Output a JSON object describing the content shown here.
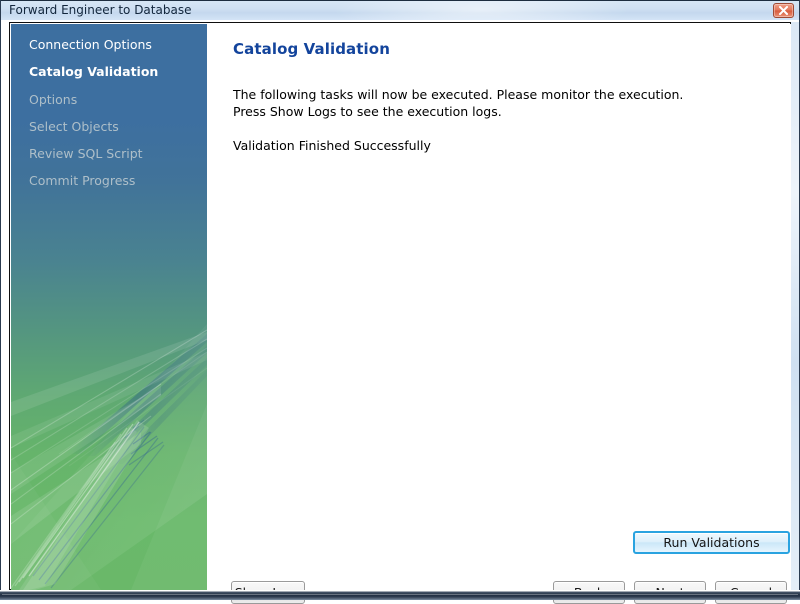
{
  "window": {
    "title": "Forward Engineer to Database",
    "close_icon": "close-icon",
    "close_label": "Close"
  },
  "sidebar": {
    "items": [
      {
        "label": "Connection Options",
        "state": "done"
      },
      {
        "label": "Catalog Validation",
        "state": "current"
      },
      {
        "label": "Options",
        "state": "todo"
      },
      {
        "label": "Select Objects",
        "state": "todo"
      },
      {
        "label": "Review SQL Script",
        "state": "todo"
      },
      {
        "label": "Commit Progress",
        "state": "todo"
      }
    ]
  },
  "main": {
    "heading": "Catalog Validation",
    "intro": "The following tasks will now be executed. Please monitor the execution.\nPress Show Logs to see the execution logs.",
    "status": "Validation Finished Successfully"
  },
  "buttons": {
    "run_validations": "Run Validations",
    "show_logs": "Show Logs",
    "back": "Back",
    "next": "Next",
    "cancel": "Cancel"
  },
  "colors": {
    "heading": "#13449c",
    "sidebar_top": "#3d6fa0",
    "sidebar_bottom": "#6ab869",
    "focus_border": "#2aa3e0",
    "titlebar": "#cfe0f2",
    "close_button": "#e2765a"
  }
}
